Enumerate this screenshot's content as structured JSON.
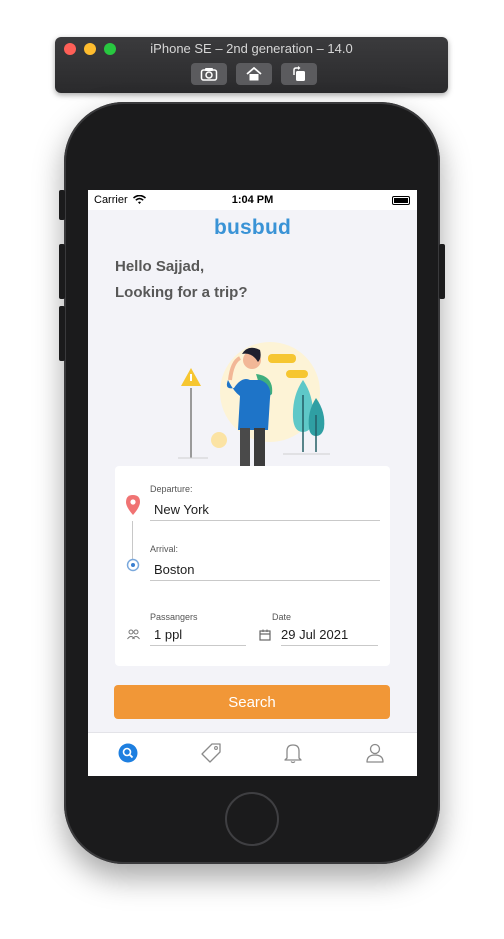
{
  "simulator": {
    "title": "iPhone SE – 2nd generation – 14.0",
    "toolbar": [
      {
        "icon": "screenshot-icon"
      },
      {
        "icon": "home-icon"
      },
      {
        "icon": "rotate-icon"
      }
    ]
  },
  "status_bar": {
    "carrier": "Carrier",
    "time": "1:04 PM"
  },
  "app": {
    "logo": "busbud",
    "greeting_line1": "Hello Sajjad,",
    "greeting_line2": "Looking for a trip?"
  },
  "form": {
    "departure_label": "Departure:",
    "departure_value": "New York",
    "arrival_label": "Arrival:",
    "arrival_value": "Boston",
    "passengers_label": "Passangers",
    "passengers_value": "1 ppl",
    "date_label": "Date",
    "date_value": "29 Jul 2021"
  },
  "search_button": {
    "label": "Search"
  },
  "tab_bar": {
    "items": [
      {
        "icon": "search-icon",
        "active": true
      },
      {
        "icon": "tag-icon",
        "active": false
      },
      {
        "icon": "bell-icon",
        "active": false
      },
      {
        "icon": "profile-icon",
        "active": false
      }
    ]
  },
  "colors": {
    "brand": "#3a93d6",
    "accent": "#f19737",
    "active_tab": "#1e7fe0"
  }
}
